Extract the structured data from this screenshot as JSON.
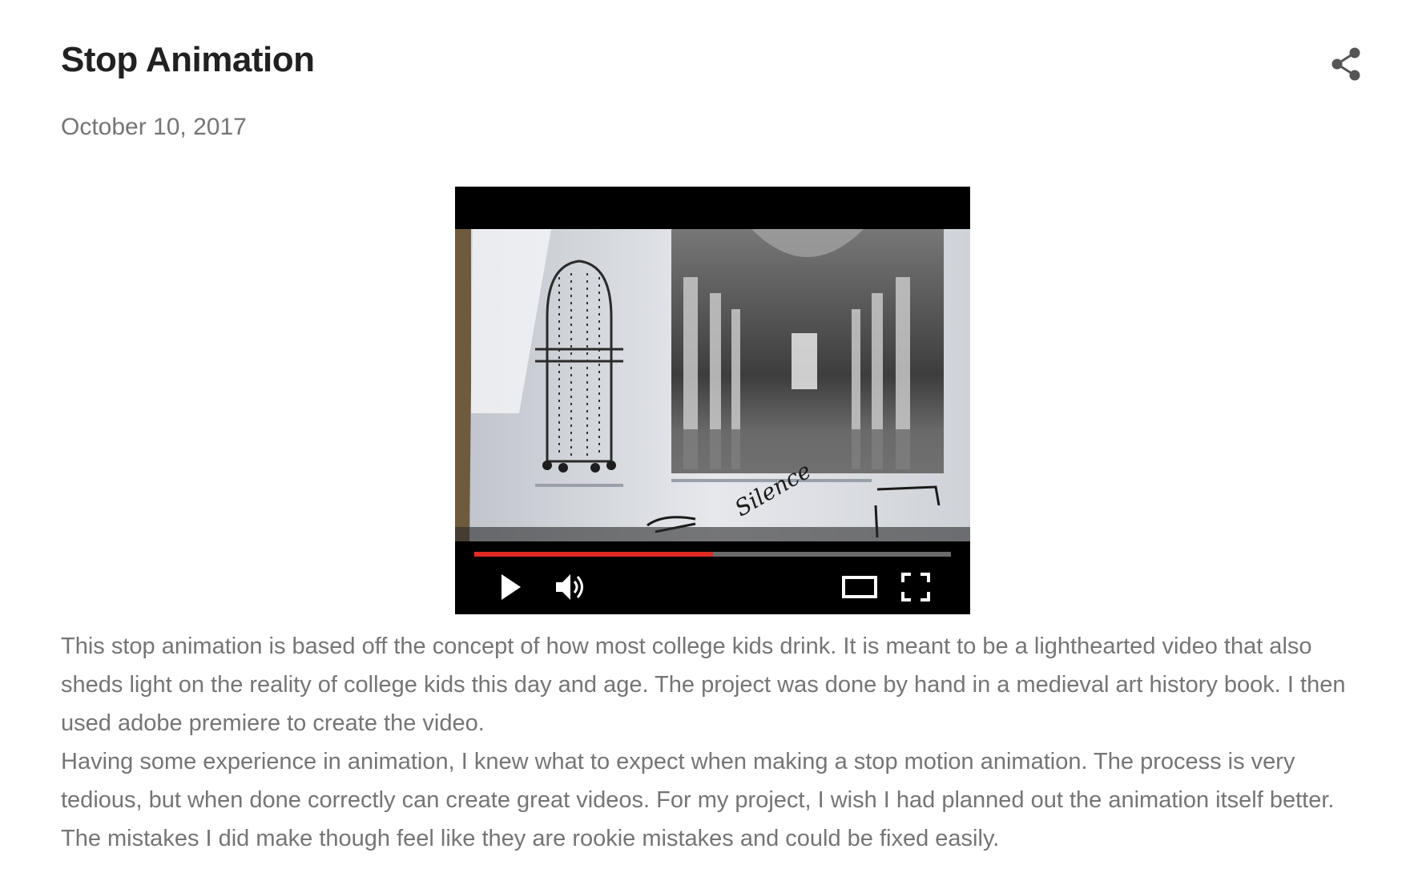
{
  "post": {
    "title": "Stop Animation",
    "date": "October 10, 2017",
    "paragraphs": [
      "This stop animation is based off the concept of how most college kids drink. It is meant to be a lighthearted video that also sheds light on the reality of college kids this day and age. The project was done by hand in a medieval art history book. I then used adobe premiere to create the video.",
      "Having some experience in animation, I knew what to expect when making a stop motion animation. The process is very tedious, but when done correctly can create great videos. For my project, I wish I had planned out the animation itself better. The mistakes I did make though feel like they are rookie mistakes and could be fixed easily."
    ]
  },
  "share": {
    "icon": "share-icon"
  },
  "video": {
    "frame_annotation": "Silence",
    "progress": 0.5,
    "colors": {
      "progress": "#e02a24",
      "track": "#6b6b6b",
      "background": "#000000"
    },
    "controls": {
      "play_icon": "play-icon",
      "volume_icon": "volume-icon",
      "theater_icon": "theater-mode-icon",
      "fullscreen_icon": "fullscreen-icon"
    }
  }
}
